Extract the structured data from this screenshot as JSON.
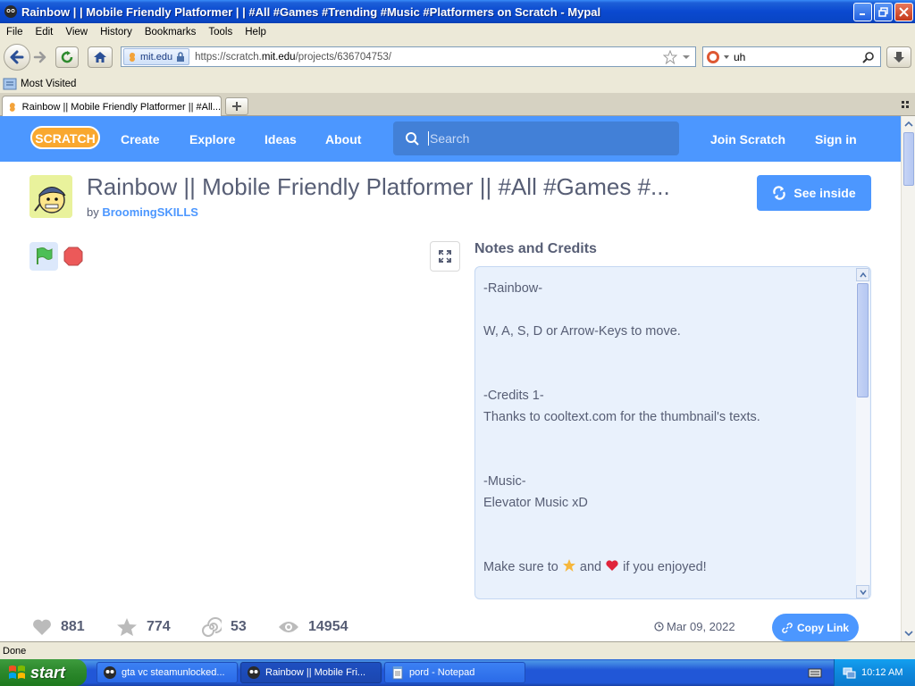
{
  "window": {
    "title": "Rainbow | | Mobile Friendly Platformer | | #All #Games #Trending #Music #Platformers on Scratch - Mypal"
  },
  "menu": [
    "File",
    "Edit",
    "View",
    "History",
    "Bookmarks",
    "Tools",
    "Help"
  ],
  "address": {
    "identity": "mit.edu",
    "url_prefix": "https://scratch.",
    "url_domain": "mit.edu",
    "url_path": "/projects/636704753/"
  },
  "search": {
    "value": "uh"
  },
  "bookmarks": {
    "most_visited": "Most Visited"
  },
  "tabs": [
    {
      "label": "Rainbow || Mobile Friendly Platformer || #All..."
    }
  ],
  "scratch": {
    "nav": {
      "create": "Create",
      "explore": "Explore",
      "ideas": "Ideas",
      "about": "About",
      "join": "Join Scratch",
      "signin": "Sign in"
    },
    "search_placeholder": "Search",
    "logo_text": "SCRATCH"
  },
  "project": {
    "title": "Rainbow || Mobile Friendly Platformer || #All #Games #...",
    "by_prefix": "by",
    "author": "BroomingSKILLS",
    "see_inside": "See inside",
    "notes_label": "Notes and Credits",
    "notes_lines": [
      "-Rainbow-",
      "",
      "W, A, S, D or Arrow-Keys to move.",
      "",
      "",
      "-Credits 1-",
      "Thanks to cooltext.com for the thumbnail's texts.",
      "",
      "",
      "-Music-",
      "Elevator Music xD",
      "",
      "",
      ""
    ],
    "final_line": {
      "pre": "Make sure to",
      "mid": "and",
      "post": "if you enjoyed!"
    },
    "stats": {
      "loves": "881",
      "favorites": "774",
      "remixes": "53",
      "views": "14954"
    },
    "shared_date": "Mar 09, 2022",
    "copy_link": "Copy Link"
  },
  "status": {
    "text": "Done"
  },
  "taskbar": {
    "start": "start",
    "tasks": [
      "gta vc steamunlocked...",
      "Rainbow || Mobile Fri...",
      "pord - Notepad"
    ],
    "clock": "10:12 AM"
  },
  "colors": {
    "scratch_blue": "#4C97FF",
    "xp_blue": "#0A49D0",
    "text_gray": "#575E75"
  }
}
